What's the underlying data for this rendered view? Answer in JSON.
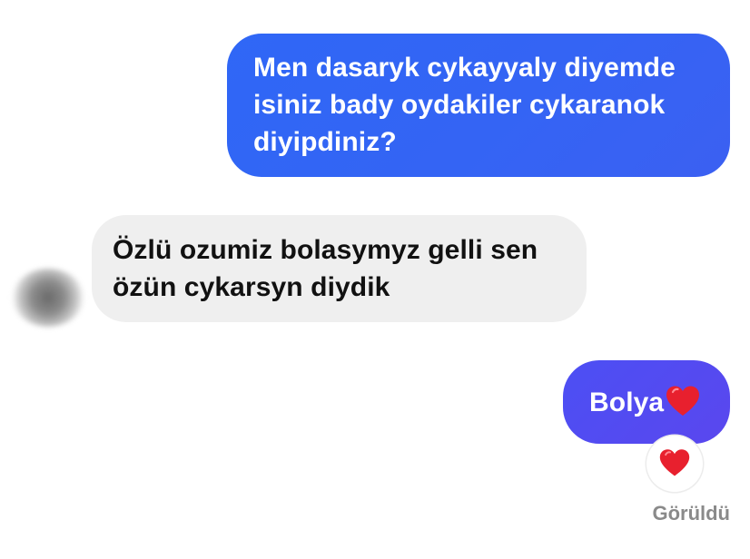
{
  "conversation": {
    "messages": [
      {
        "direction": "outgoing",
        "text": "Men dasaryk cykayyaly diyemde\nisiniz bady oydakiler cykaranok\ndiyipdiniz?"
      },
      {
        "direction": "incoming",
        "text": "Özlü ozumiz bolasymyz gelli sen\nözün cykarsyn diydik"
      },
      {
        "direction": "outgoing",
        "text": "Bolya",
        "emoji": "red-heart-icon"
      }
    ],
    "reaction": {
      "emoji": "red-heart-icon"
    },
    "status": "Görüldü"
  },
  "colors": {
    "outgoing_bubble": "#3366f5",
    "outgoing_bubble_alt": "#5149f1",
    "incoming_bubble": "#efefef",
    "heart": "#e8202e",
    "status_text": "#8a8a8a"
  }
}
